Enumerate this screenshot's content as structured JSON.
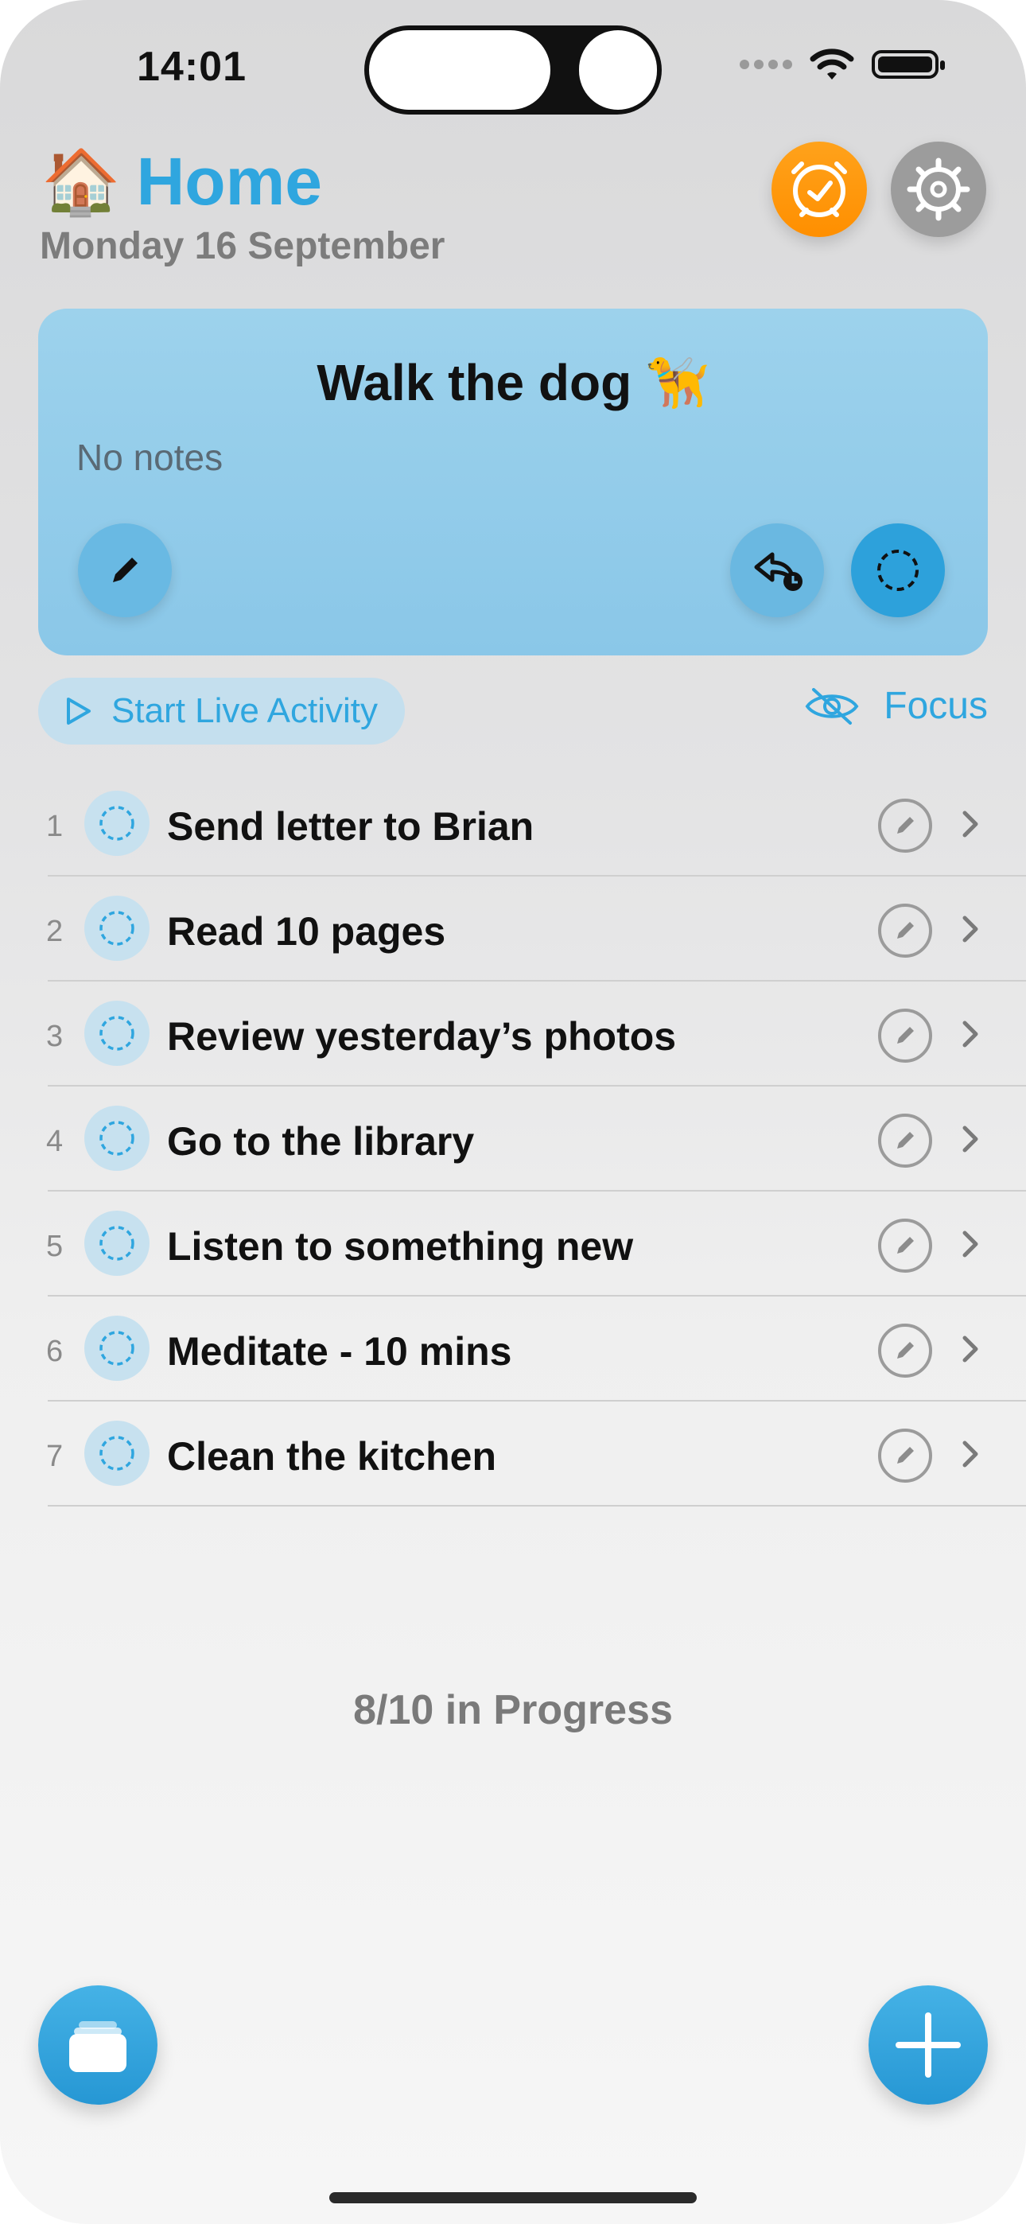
{
  "status_bar": {
    "time": "14:01"
  },
  "header": {
    "emoji": "🏠",
    "title": "Home",
    "date": "Monday 16 September"
  },
  "current_task": {
    "title": "Walk the dog 🦮",
    "notes": "No notes"
  },
  "actions": {
    "live_activity_label": "Start Live Activity",
    "focus_label": "Focus"
  },
  "tasks": [
    {
      "number": "1",
      "title": "Send letter to Brian"
    },
    {
      "number": "2",
      "title": "Read 10 pages"
    },
    {
      "number": "3",
      "title": "Review yesterday’s photos"
    },
    {
      "number": "4",
      "title": "Go to the library"
    },
    {
      "number": "5",
      "title": "Listen to something new"
    },
    {
      "number": "6",
      "title": "Meditate - 10 mins"
    },
    {
      "number": "7",
      "title": "Clean the kitchen"
    }
  ],
  "progress_text": "8/10 in Progress",
  "colors": {
    "accent": "#2fa6df",
    "alarm": "#ff9a10",
    "card": "#8fcae9"
  },
  "icons": {
    "alarm": "alarm-clock-icon",
    "settings": "gear-icon",
    "edit": "pencil-icon",
    "defer": "defer-arrow-icon",
    "complete": "dashed-circle-icon",
    "play": "play-icon",
    "focus": "eye-slash-icon",
    "chevron": "chevron-right-icon",
    "lists": "stack-icon",
    "add": "plus-icon"
  }
}
